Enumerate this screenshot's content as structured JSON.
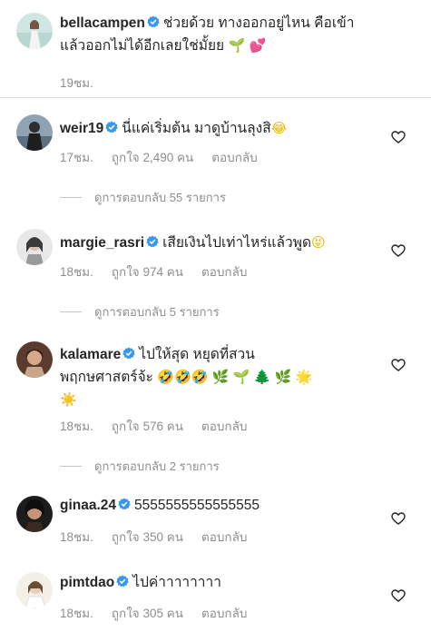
{
  "caption": {
    "username": "bellacampen",
    "text_line1": "ช่วยด้วย ทางออกอยู่ไหน คือเข้า",
    "text_line2": "แล้วออกไม่ได้อีกเลยใช่มั้ยย",
    "emojis": [
      "🌱",
      "💕"
    ],
    "time": "19ชม."
  },
  "comments": [
    {
      "username": "weir19",
      "text_line1": "นี่แค่เริ่มต้น มาดูบ้านลุงสิ",
      "emojis_line1": [
        "😂"
      ],
      "time": "17ชม.",
      "likes": "ถูกใจ 2,490 คน",
      "reply": "ตอบกลับ",
      "view_replies": "ดูการตอบกลับ 55 รายการ"
    },
    {
      "username": "margie_rasri",
      "text_line1": "เสียเงินไปเท่าไหร่แล้วพูด",
      "emojis_line1": [
        "😝"
      ],
      "time": "18ชม.",
      "likes": "ถูกใจ 974 คน",
      "reply": "ตอบกลับ",
      "view_replies": "ดูการตอบกลับ 5 รายการ"
    },
    {
      "username": "kalamare",
      "text_line1": "ไปให้สุด หยุดที่สวน",
      "text_line2": "พฤกษศาสตร์จ้ะ",
      "emojis_line2": [
        "🤣",
        "🤣",
        "🤣",
        "🌿",
        "🌱",
        "🌲",
        "🌿",
        "🌟"
      ],
      "emojis_line3": [
        "☀️"
      ],
      "time": "18ชม.",
      "likes": "ถูกใจ 576 คน",
      "reply": "ตอบกลับ",
      "view_replies": "ดูการตอบกลับ 2 รายการ"
    },
    {
      "username": "ginaa.24",
      "text_line1": "5555555555555555",
      "time": "18ชม.",
      "likes": "ถูกใจ 350 คน",
      "reply": "ตอบกลับ"
    },
    {
      "username": "pimtdao",
      "text_line1": "ไปค่าาาาาาาา",
      "time": "18ชม.",
      "likes": "ถูกใจ 305 คน",
      "reply": "ตอบกลับ"
    }
  ],
  "colors": {
    "text": "#262626",
    "meta": "#8e8e8e",
    "verified": "#3897f0",
    "divider": "#dbdbdb"
  }
}
